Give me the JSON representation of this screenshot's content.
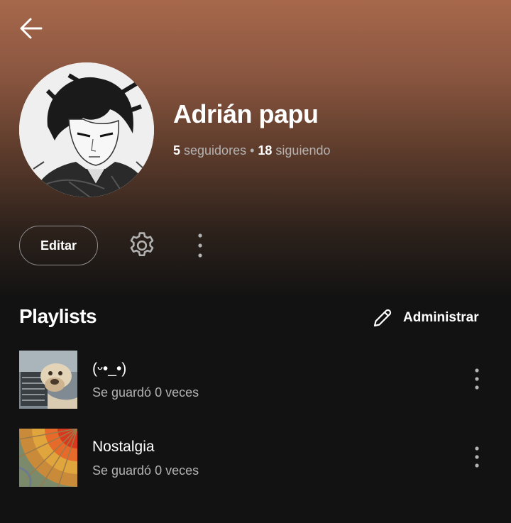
{
  "profile": {
    "name": "Adrián papu",
    "followers_count": "5",
    "followers_label": " seguidores • ",
    "following_count": "18",
    "following_label": " siguiendo"
  },
  "actions": {
    "edit_label": "Editar"
  },
  "playlists_section": {
    "title": "Playlists",
    "manage_label": "Administrar",
    "items": [
      {
        "title": "(ᵕ•_•)",
        "subtitle": "Se guardó 0 veces"
      },
      {
        "title": "Nostalgia",
        "subtitle": "Se guardó 0 veces"
      }
    ]
  },
  "colors": {
    "header_gradient_top": "#a7684b",
    "background": "#121212",
    "secondary_text": "#b3b3b3"
  },
  "icons": [
    "arrow-left-icon",
    "gear-icon",
    "more-vertical-icon",
    "pencil-icon"
  ]
}
